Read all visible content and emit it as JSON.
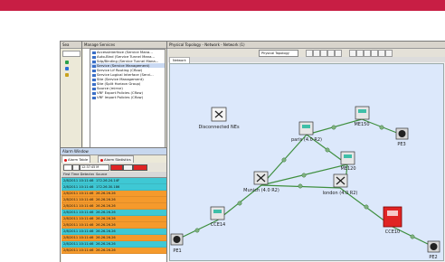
{
  "windows": {
    "search": {
      "title": "Sea"
    },
    "manage": {
      "title": "Manage Services",
      "search_label": "Search"
    },
    "topology": {
      "title": "Physical Topology - Network - Network (1)",
      "view_select": "Physical Topology",
      "tab": "Network"
    },
    "alarms": {
      "title": "Alarm Window",
      "tabs": [
        "Alarm Table",
        "Alarm Statistics"
      ],
      "severity_value": "12:37:45 M",
      "columns": [
        "First Time Detected",
        "Source",
        ""
      ],
      "rows": [
        {
          "time": "2/8/2011 10:11:46 A",
          "source": "172.26.24.14F",
          "extra": "",
          "color": "#3fc8d4"
        },
        {
          "time": "2/8/2011 10:11:46 A",
          "source": "172.26.30.186",
          "extra": "",
          "color": "#3fc8d4"
        },
        {
          "time": "2/8/2011 10:11:46 A",
          "source": "26.26.26.26",
          "extra": "",
          "color": "#f59a2c"
        },
        {
          "time": "2/8/2011 10:11:46 A",
          "source": "26.26.26.26",
          "extra": "",
          "color": "#f59a2c"
        },
        {
          "time": "2/8/2011 10:11:46 A",
          "source": "26.26.26.26",
          "extra": "",
          "color": "#f59a2c"
        },
        {
          "time": "2/8/2011 10:11:46 A",
          "source": "26.26.26.26",
          "extra": "",
          "color": "#3fc8d4"
        },
        {
          "time": "2/8/2011 10:11:46 A",
          "source": "26.26.26.26",
          "extra": "",
          "color": "#f59a2c"
        },
        {
          "time": "2/8/2011 10:11:46 A",
          "source": "26.26.26.26",
          "extra": "",
          "color": "#f59a2c"
        },
        {
          "time": "2/8/2011 10:11:46 A",
          "source": "26.26.26.26",
          "extra": "",
          "color": "#3fc8d4"
        },
        {
          "time": "2/8/2011 10:11:46 A",
          "source": "26.26.26.26",
          "extra": "",
          "color": "#f59a2c"
        },
        {
          "time": "2/8/2011 10:11:46 A",
          "source": "26.26.26.26",
          "extra": "",
          "color": "#3fc8d4"
        },
        {
          "time": "2/8/2011 10:11:46 A",
          "source": "26.26.26.26",
          "extra": "",
          "color": "#f59a2c"
        }
      ]
    }
  },
  "services": [
    "AccessInterface (Service Mana...",
    "Auto-Bind (Service Tunnel Mana...",
    "Sdp/Binding (Service Tunnel Mana...",
    "Service (Service Management)",
    "Service Lif Routing (Cflow)",
    "Service Logical Interface (Servi...",
    "Site (Service Management)",
    "Site (Split Horizon Group)",
    "Source (mirror)",
    "VRF Export Policies (Cflow)",
    "VRF Import Policies (Cflow)"
  ],
  "topology_nodes": {
    "disconnected": "Disconnected NEs",
    "paris": "paris (4.0 R2)",
    "me150": "ME150",
    "pe3": "PE3",
    "me120": "ME120",
    "munich": "Munich (4.0 R2)",
    "london": "london (4.0 R2)",
    "cce14": "CCE14",
    "cce10": "CCE10",
    "pe1": "PE1",
    "pe2": "PE2"
  },
  "colors": {
    "brand_bar": "#c81e44",
    "canvas": "#dce8fb",
    "alarm_critical": "#e02424",
    "row_cyan": "#3fc8d4",
    "row_orange": "#f59a2c"
  }
}
